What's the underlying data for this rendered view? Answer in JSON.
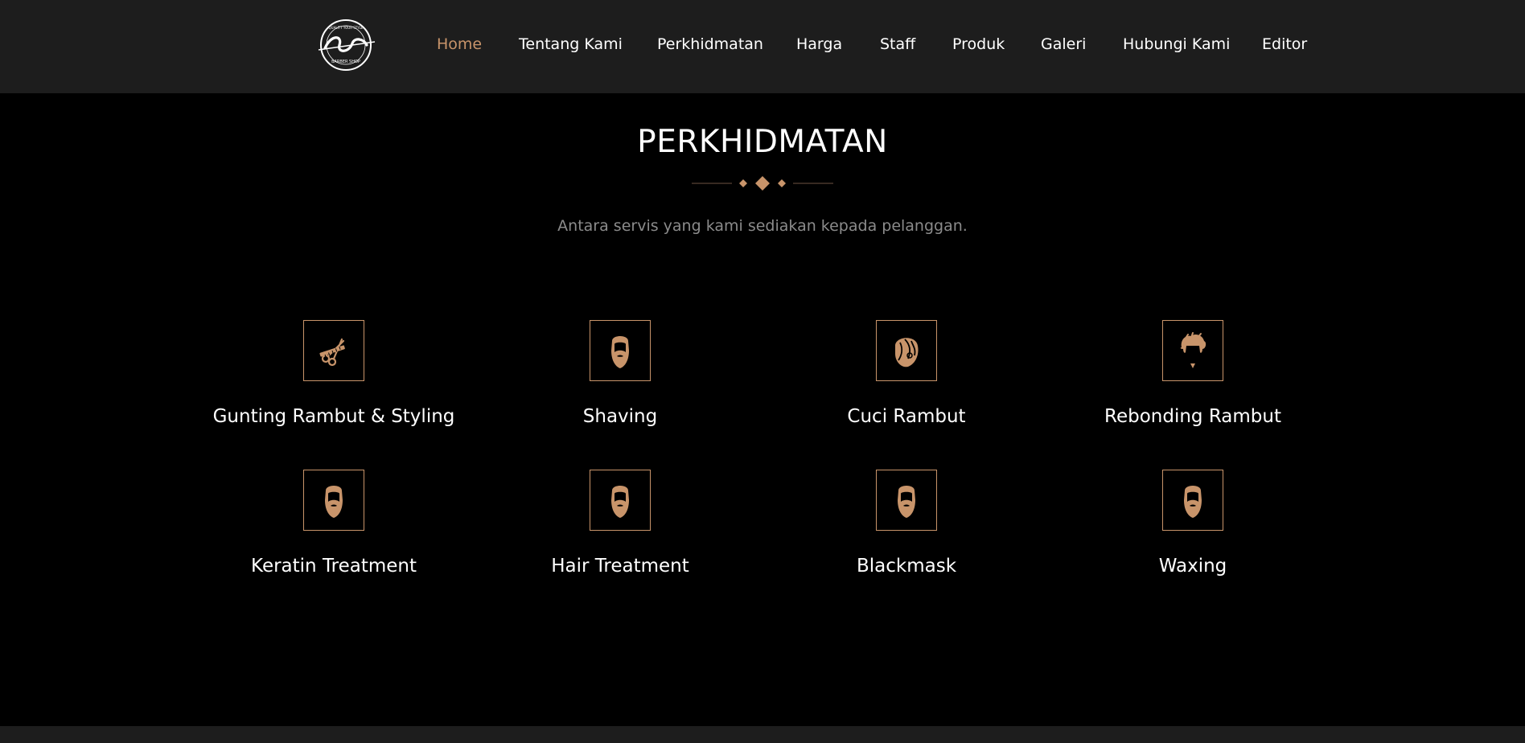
{
  "brand": {
    "logo_text": "Hudbaba",
    "logo_tagline": "BARBER SHOP",
    "logo_top_text": "QUALITY YOUR STYLE",
    "logo_icon": "circular-script-logo"
  },
  "nav": {
    "items": [
      {
        "label": "Home",
        "active": true
      },
      {
        "label": "Tentang Kami",
        "active": false
      },
      {
        "label": "Perkhidmatan",
        "active": false
      },
      {
        "label": "Harga",
        "active": false
      },
      {
        "label": "Staff",
        "active": false
      },
      {
        "label": "Produk",
        "active": false
      },
      {
        "label": "Galeri",
        "active": false
      },
      {
        "label": "Hubungi Kami",
        "active": false
      },
      {
        "label": "Editor",
        "active": false
      }
    ]
  },
  "section": {
    "title": "PERKHIDMATAN",
    "subtitle": "Antara servis yang kami sediakan kepada pelanggan.",
    "divider_icon": "diamond-ornament-icon"
  },
  "services": [
    {
      "label": "Gunting Rambut & Styling",
      "icon": "scissors-comb-icon"
    },
    {
      "label": "Shaving",
      "icon": "beard-face-icon"
    },
    {
      "label": "Cuci Rambut",
      "icon": "hair-wash-icon"
    },
    {
      "label": "Rebonding Rambut",
      "icon": "hair-style-icon"
    },
    {
      "label": "Keratin Treatment",
      "icon": "beard-face-icon"
    },
    {
      "label": "Hair Treatment",
      "icon": "beard-face-icon"
    },
    {
      "label": "Blackmask",
      "icon": "beard-face-icon"
    },
    {
      "label": "Waxing",
      "icon": "beard-face-icon"
    }
  ],
  "colors": {
    "accent": "#c8946a",
    "header_bg": "#1d1d1d",
    "page_bg": "#000000",
    "text": "#ffffff",
    "muted_text": "#8b8b8b"
  }
}
